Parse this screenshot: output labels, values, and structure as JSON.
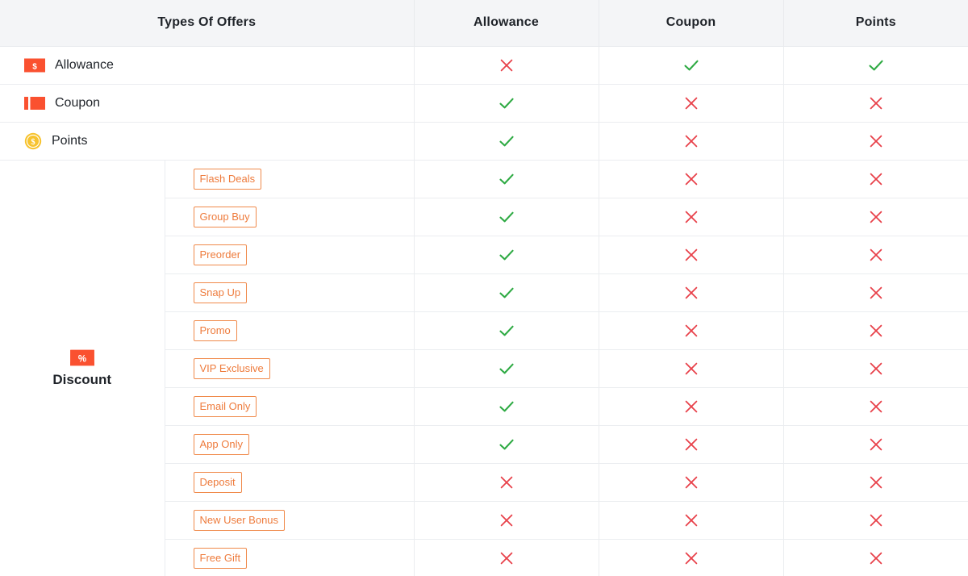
{
  "table": {
    "columns": [
      {
        "key": "types",
        "label": "Types Of Offers",
        "name": "column-header-types-of-offers"
      },
      {
        "key": "allowance",
        "label": "Allowance",
        "name": "column-header-allowance"
      },
      {
        "key": "coupon",
        "label": "Coupon",
        "name": "column-header-coupon"
      },
      {
        "key": "points",
        "label": "Points",
        "name": "column-header-points"
      }
    ],
    "top_rows": [
      {
        "label": "Allowance",
        "icon": "ticket-dollar-icon",
        "allowance": "cross",
        "coupon": "check",
        "points": "check"
      },
      {
        "label": "Coupon",
        "icon": "coupon-ticket-icon",
        "allowance": "check",
        "coupon": "cross",
        "points": "cross"
      },
      {
        "label": "Points",
        "icon": "coin-dollar-icon",
        "allowance": "check",
        "coupon": "cross",
        "points": "cross"
      }
    ],
    "group": {
      "label": "Discount",
      "icon": "ticket-percent-icon",
      "rows": [
        {
          "tag": "Flash Deals",
          "allowance": "check",
          "coupon": "cross",
          "points": "cross"
        },
        {
          "tag": "Group Buy",
          "allowance": "check",
          "coupon": "cross",
          "points": "cross"
        },
        {
          "tag": "Preorder",
          "allowance": "check",
          "coupon": "cross",
          "points": "cross"
        },
        {
          "tag": "Snap Up",
          "allowance": "check",
          "coupon": "cross",
          "points": "cross"
        },
        {
          "tag": "Promo",
          "allowance": "check",
          "coupon": "cross",
          "points": "cross"
        },
        {
          "tag": "VIP Exclusive",
          "allowance": "check",
          "coupon": "cross",
          "points": "cross"
        },
        {
          "tag": "Email Only",
          "allowance": "check",
          "coupon": "cross",
          "points": "cross"
        },
        {
          "tag": "App Only",
          "allowance": "check",
          "coupon": "cross",
          "points": "cross"
        },
        {
          "tag": "Deposit",
          "allowance": "cross",
          "coupon": "cross",
          "points": "cross"
        },
        {
          "tag": "New User Bonus",
          "allowance": "cross",
          "coupon": "cross",
          "points": "cross"
        },
        {
          "tag": "Free Gift",
          "allowance": "cross",
          "coupon": "cross",
          "points": "cross"
        }
      ]
    }
  },
  "colors": {
    "header_bg": "#f4f5f7",
    "border": "#ebedf0",
    "text": "#1f2329",
    "tag_border": "#f08a4b",
    "tag_text": "#ee7b3c",
    "check_green": "#2eaa43",
    "cross_red": "#e8414a",
    "ticket_orange": "#fa5130",
    "coin_yellow": "#f7c32e"
  },
  "icon_glyphs": {
    "check": "check-mark-icon",
    "cross": "cross-mark-icon"
  }
}
